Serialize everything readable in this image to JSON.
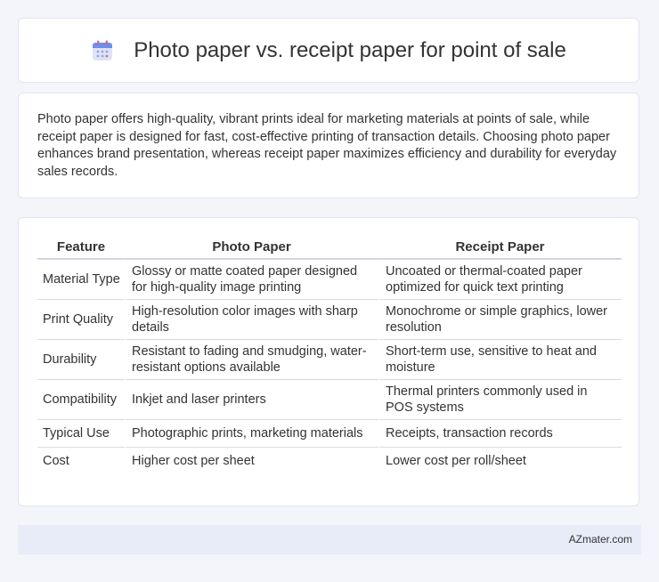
{
  "header": {
    "title": "Photo paper vs. receipt paper for point of sale",
    "icon": "calendar-icon"
  },
  "summary": {
    "text": "Photo paper offers high-quality, vibrant prints ideal for marketing materials at points of sale, while receipt paper is designed for fast, cost-effective printing of transaction details. Choosing photo paper enhances brand presentation, whereas receipt paper maximizes efficiency and durability for everyday sales records."
  },
  "table": {
    "columns": [
      "Feature",
      "Photo Paper",
      "Receipt Paper"
    ],
    "rows": [
      [
        "Material Type",
        "Glossy or matte coated paper designed for high-quality image printing",
        "Uncoated or thermal-coated paper optimized for quick text printing"
      ],
      [
        "Print Quality",
        "High-resolution color images with sharp details",
        "Monochrome or simple graphics, lower resolution"
      ],
      [
        "Durability",
        "Resistant to fading and smudging, water-resistant options available",
        "Short-term use, sensitive to heat and moisture"
      ],
      [
        "Compatibility",
        "Inkjet and laser printers",
        "Thermal printers commonly used in POS systems"
      ],
      [
        "Typical Use",
        "Photographic prints, marketing materials",
        "Receipts, transaction records"
      ],
      [
        "Cost",
        "Higher cost per sheet",
        "Lower cost per roll/sheet"
      ]
    ]
  },
  "footer": {
    "brand": "AZmater.com"
  },
  "colors": {
    "page_bg": "#f3f5fa",
    "card_bg": "#ffffff",
    "footer_bg": "#e8ecf8",
    "text": "#333333"
  }
}
